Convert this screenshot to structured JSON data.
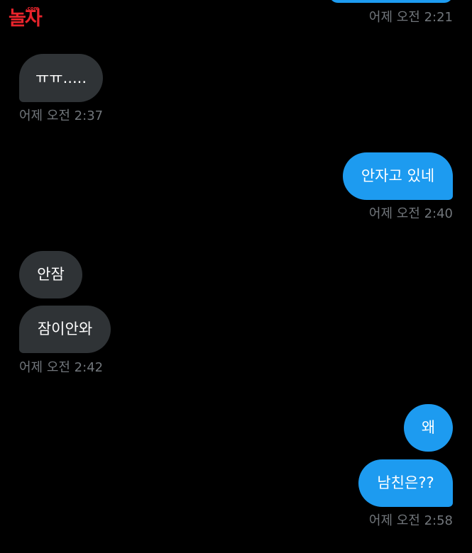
{
  "watermark": {
    "logo_text": "놀자",
    "logo_sub": ".com"
  },
  "messages": [
    {
      "id": "m0",
      "direction": "out",
      "text": ""
    },
    {
      "id": "m1",
      "direction": "in",
      "text": "ㅠㅠ....."
    },
    {
      "id": "m2",
      "direction": "out",
      "text": "안자고 있네"
    },
    {
      "id": "m3",
      "direction": "in",
      "text": "안잠"
    },
    {
      "id": "m4",
      "direction": "in",
      "text": "잠이안와"
    },
    {
      "id": "m5",
      "direction": "out",
      "text": "왜"
    },
    {
      "id": "m6",
      "direction": "out",
      "text": "남친은??"
    }
  ],
  "timestamps": [
    {
      "id": "t0",
      "text": "어제 오전 2:21"
    },
    {
      "id": "t1",
      "text": "어제 오전 2:37"
    },
    {
      "id": "t2",
      "text": "어제 오전 2:40"
    },
    {
      "id": "t3",
      "text": "어제 오전 2:42"
    },
    {
      "id": "t4",
      "text": "어제 오전 2:58"
    }
  ],
  "colors": {
    "background": "#000000",
    "incoming_bubble": "#2f3336",
    "outgoing_bubble": "#1d9bf0",
    "timestamp": "#71767b",
    "logo": "#e8242c"
  }
}
